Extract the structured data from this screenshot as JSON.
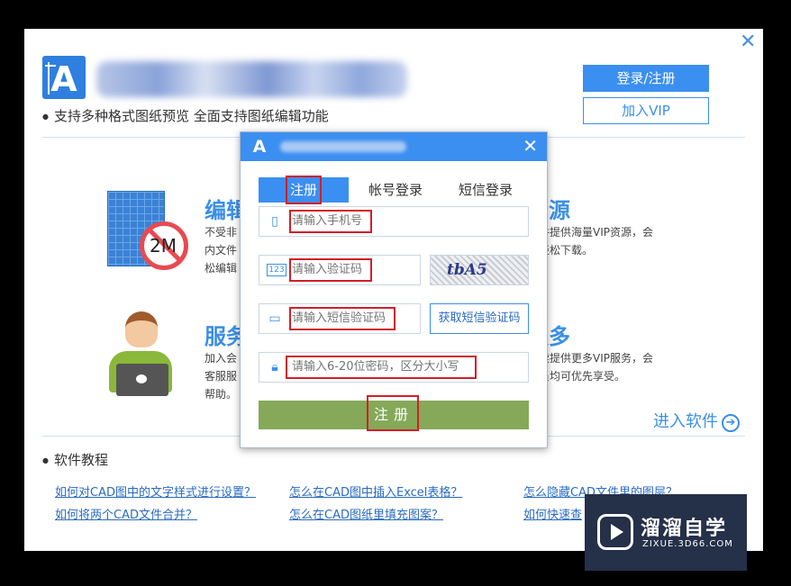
{
  "window": {
    "subtitle": "支持多种格式图纸预览 全面支持图纸编辑功能",
    "login_label": "登录/注册",
    "vip_label": "加入VIP",
    "enter_label": "进入软件",
    "tutorial_title": "软件教程"
  },
  "features": {
    "edit": {
      "title": "编辑",
      "text_lines": [
        "不受非",
        "内文件",
        "松编辑"
      ],
      "badge": "2M"
    },
    "resources": {
      "title": "资源",
      "text_lines": [
        "件提供海量VIP资源，会",
        "轻松下载。"
      ]
    },
    "service": {
      "title": "服务",
      "text_lines": [
        "加入会",
        "客服服",
        "帮助。"
      ]
    },
    "more": {
      "title": "更多",
      "text_lines": [
        "续提供更多VIP服务，会",
        "员均可优先享受。"
      ]
    }
  },
  "tutorials": [
    "如何对CAD图中的文字样式进行设置？",
    "怎么在CAD图中插入Excel表格？",
    "怎么隐藏CAD文件里的图层？",
    "如何将两个CAD文件合并？",
    "怎么在CAD图纸里填充图案？",
    "如何快速查"
  ],
  "dialog": {
    "tabs": [
      "注册",
      "帐号登录",
      "短信登录"
    ],
    "phone_placeholder": "请输入手机号",
    "captcha_placeholder": "请输入验证码",
    "captcha_text": "tbA5",
    "sms_placeholder": "请输入短信验证码",
    "sms_button": "获取短信验证码",
    "password_placeholder": "请输入6-20位密码，区分大小写",
    "register_button": "注册"
  },
  "watermark": {
    "title": "溜溜自学",
    "url": "ZIXUE.3D66.COM"
  },
  "colors": {
    "accent": "#3b8ff0",
    "register": "#85a958",
    "highlight": "#d21f2a"
  }
}
